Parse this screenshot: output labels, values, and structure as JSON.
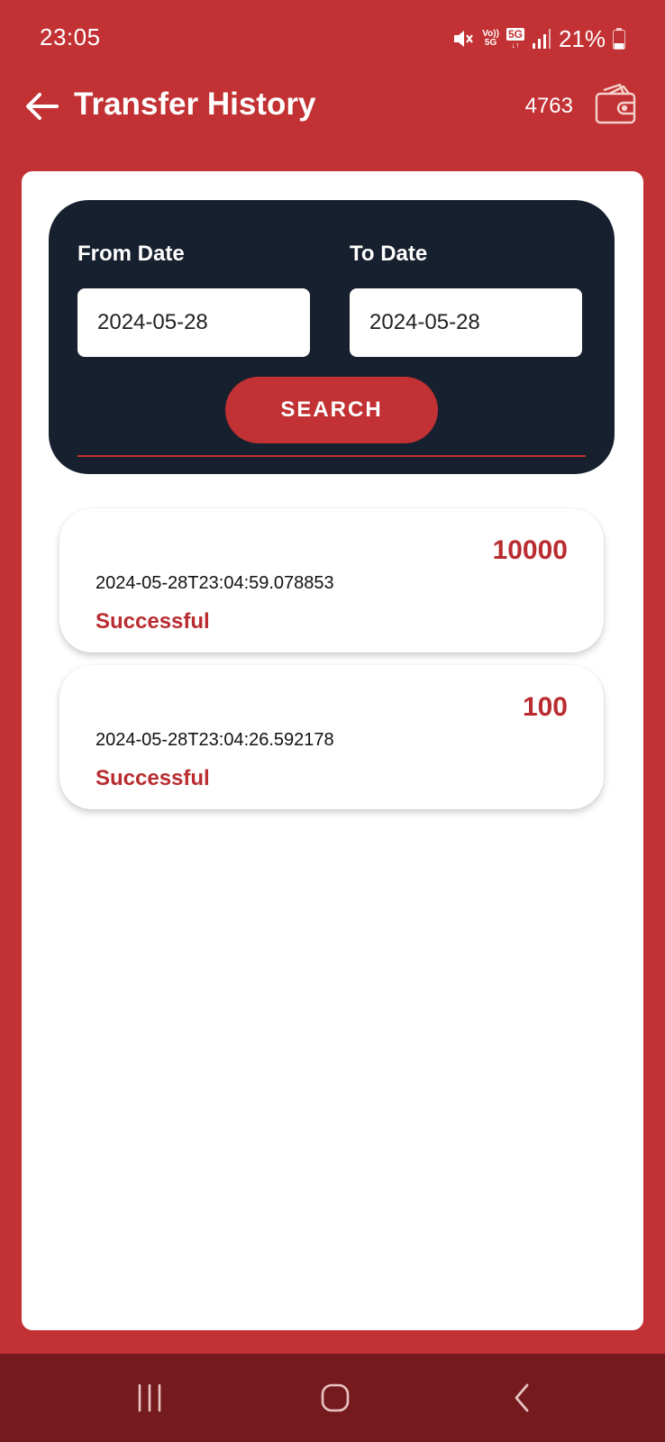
{
  "status_bar": {
    "time": "23:05",
    "volte_top": "Vo))",
    "volte_bottom": "5G",
    "network": "5G",
    "battery": "21%"
  },
  "app_bar": {
    "title": "Transfer History",
    "balance": "4763"
  },
  "filter": {
    "from_label": "From Date",
    "from_value": "2024-05-28",
    "to_label": "To Date",
    "to_value": "2024-05-28",
    "search_label": "SEARCH"
  },
  "transfers": [
    {
      "amount": "10000",
      "timestamp": "2024-05-28T23:04:59.078853",
      "status": "Successful"
    },
    {
      "amount": "100",
      "timestamp": "2024-05-28T23:04:26.592178",
      "status": "Successful"
    }
  ],
  "icons": {
    "back": "back-arrow-icon",
    "wallet": "wallet-icon",
    "nav_recent": "recent-apps-icon",
    "nav_home": "home-icon",
    "nav_back": "nav-back-icon"
  },
  "colors": {
    "brand_red": "#c23133",
    "panel_dark": "#17202e",
    "nav_dark": "#761b1d",
    "accent_text": "#b92c30"
  }
}
